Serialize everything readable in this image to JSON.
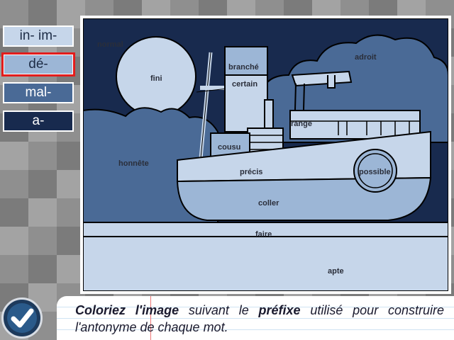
{
  "prefixes": [
    {
      "label": "in- im-",
      "fill": "#c6d6ea",
      "text_color": "#1d2c46"
    },
    {
      "label": "dé-",
      "fill": "#9cb6d6",
      "text_color": "#1d2c46",
      "selected": true
    },
    {
      "label": "mal-",
      "fill": "#4a6a96",
      "text_color": "#ffffff"
    },
    {
      "label": "a-",
      "fill": "#182a4e",
      "text_color": "#ffffff"
    }
  ],
  "words": {
    "normal": "normal",
    "fini": "fini",
    "branche": "branché",
    "certain": "certain",
    "adroit": "adroit",
    "range": "rangé",
    "cousu": "cousu",
    "honnete": "honnête",
    "precis": "précis",
    "possible": "possible",
    "coller": "coller",
    "faire": "faire",
    "apte": "apte"
  },
  "instructions": {
    "part1": "Coloriez l'image",
    "part2": " suivant le ",
    "part3": "préfixe",
    "part4": " utilisé pour construire l'antonyme de chaque mot."
  },
  "colors": {
    "selected_outline": "#e21d1d",
    "check_button": "#1d3a5c"
  }
}
